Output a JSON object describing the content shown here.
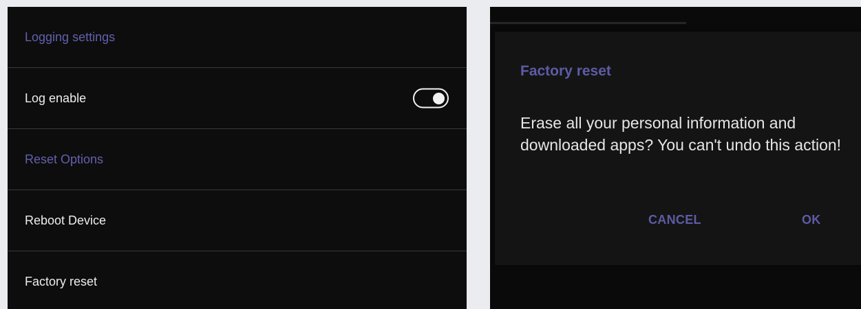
{
  "settings": {
    "rows": [
      {
        "type": "header",
        "label": "Logging settings"
      },
      {
        "type": "item",
        "label": "Log enable",
        "toggle": true
      },
      {
        "type": "header",
        "label": "Reset Options"
      },
      {
        "type": "item",
        "label": "Reboot Device"
      },
      {
        "type": "item",
        "label": "Factory reset"
      }
    ]
  },
  "dialog": {
    "title": "Factory reset",
    "message": "Erase all your personal information and downloaded apps? You can't undo this action!",
    "cancel_label": "CANCEL",
    "ok_label": "OK"
  },
  "colors": {
    "accent": "#5e5ba6",
    "panel_bg": "#0d0d0d",
    "page_bg": "#ebecef"
  }
}
